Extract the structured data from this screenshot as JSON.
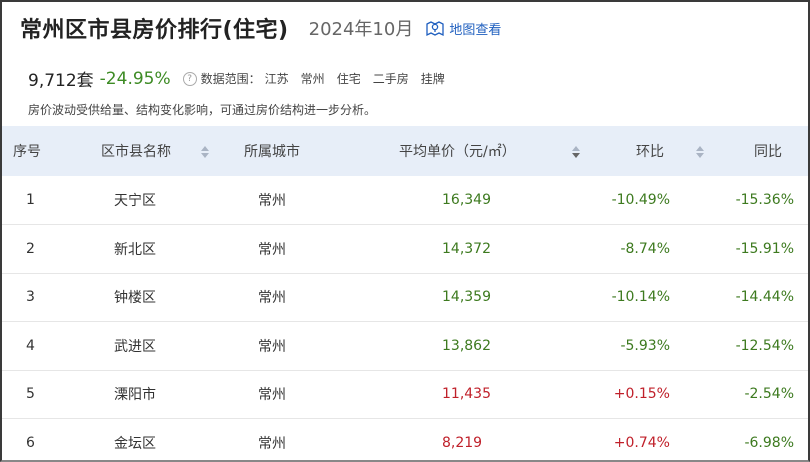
{
  "header": {
    "title": "常州区市县房价排行(住宅)",
    "date": "2024年10月",
    "map_link": "地图查看"
  },
  "summary": {
    "count": "9,712套",
    "change": "-24.95%",
    "range_label": "数据范围：",
    "range_tags": [
      "江苏",
      "常州",
      "住宅",
      "二手房",
      "挂牌"
    ],
    "note": "房价波动受供给量、结构变化影响，可通过房价结构进一步分析。"
  },
  "table": {
    "headers": {
      "rank": "序号",
      "district": "区市县名称",
      "city": "所属城市",
      "price": "平均单价（元/㎡）",
      "mom": "环比",
      "yoy": "同比"
    },
    "rows": [
      {
        "rank": "1",
        "district": "天宁区",
        "city": "常州",
        "price": "16,349",
        "mom": "-10.49%",
        "yoy": "-15.36%",
        "price_color": "green",
        "mom_color": "green",
        "yoy_color": "green"
      },
      {
        "rank": "2",
        "district": "新北区",
        "city": "常州",
        "price": "14,372",
        "mom": "-8.74%",
        "yoy": "-15.91%",
        "price_color": "green",
        "mom_color": "green",
        "yoy_color": "green"
      },
      {
        "rank": "3",
        "district": "钟楼区",
        "city": "常州",
        "price": "14,359",
        "mom": "-10.14%",
        "yoy": "-14.44%",
        "price_color": "green",
        "mom_color": "green",
        "yoy_color": "green"
      },
      {
        "rank": "4",
        "district": "武进区",
        "city": "常州",
        "price": "13,862",
        "mom": "-5.93%",
        "yoy": "-12.54%",
        "price_color": "green",
        "mom_color": "green",
        "yoy_color": "green"
      },
      {
        "rank": "5",
        "district": "溧阳市",
        "city": "常州",
        "price": "11,435",
        "mom": "+0.15%",
        "yoy": "-2.54%",
        "price_color": "red",
        "mom_color": "red",
        "yoy_color": "green"
      },
      {
        "rank": "6",
        "district": "金坛区",
        "city": "常州",
        "price": "8,219",
        "mom": "+0.74%",
        "yoy": "-6.98%",
        "price_color": "red",
        "mom_color": "red",
        "yoy_color": "green"
      }
    ]
  },
  "colors": {
    "up": "#c0202a",
    "down": "#3d7a1f",
    "header_bg": "#e7eef8",
    "link": "#1f5fbf"
  },
  "icons": {
    "map": "map-pin-icon",
    "help": "question-icon",
    "sort": "sort-arrows-icon"
  }
}
